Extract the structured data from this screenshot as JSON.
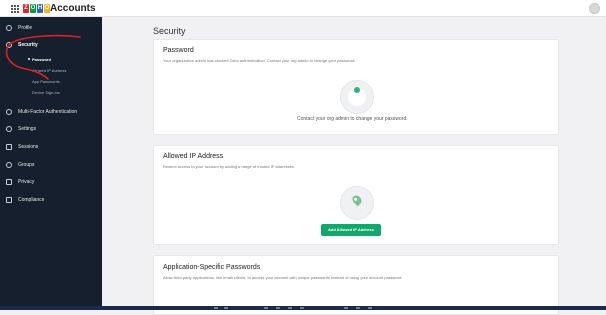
{
  "header": {
    "brand": "Accounts",
    "logo_letters": [
      "Z",
      "O",
      "H",
      "O"
    ],
    "logo_colors": [
      "#e42527",
      "#089949",
      "#226db4",
      "#f9b21d"
    ]
  },
  "sidebar": {
    "items": [
      {
        "label": "Profile",
        "icon": "profile-icon"
      },
      {
        "label": "Security",
        "icon": "shield-icon",
        "active": true
      },
      {
        "label": "Multi-Factor Authentication",
        "icon": "mfa-icon"
      },
      {
        "label": "Settings",
        "icon": "gear-icon"
      },
      {
        "label": "Sessions",
        "icon": "sessions-icon"
      },
      {
        "label": "Groups",
        "icon": "groups-icon"
      },
      {
        "label": "Privacy",
        "icon": "lock-icon"
      },
      {
        "label": "Compliance",
        "icon": "compliance-icon"
      }
    ],
    "security_sub": [
      "Password",
      "Allowed IP Address",
      "App Passwords",
      "Device Sign-ins"
    ]
  },
  "main": {
    "title": "Security",
    "password": {
      "heading": "Password",
      "desc": "Your organization admin has blocked Zoho authentication. Contact your org admin to change your password.",
      "note": "Contact your org admin to change your password."
    },
    "allowed_ip": {
      "heading": "Allowed IP Address",
      "desc": "Restrict access to your account by adding a range of trusted IP addresses.",
      "button": "Add Allowed IP Address"
    },
    "app_passwords": {
      "heading": "Application-Specific Passwords",
      "desc": "Allow third-party applications, like email clients, to access your account with unique passwords instead of using your account password."
    }
  },
  "colors": {
    "sidebar_bg": "#161f2d",
    "accent_green": "#14a66f",
    "annotation_red": "#d92323"
  }
}
